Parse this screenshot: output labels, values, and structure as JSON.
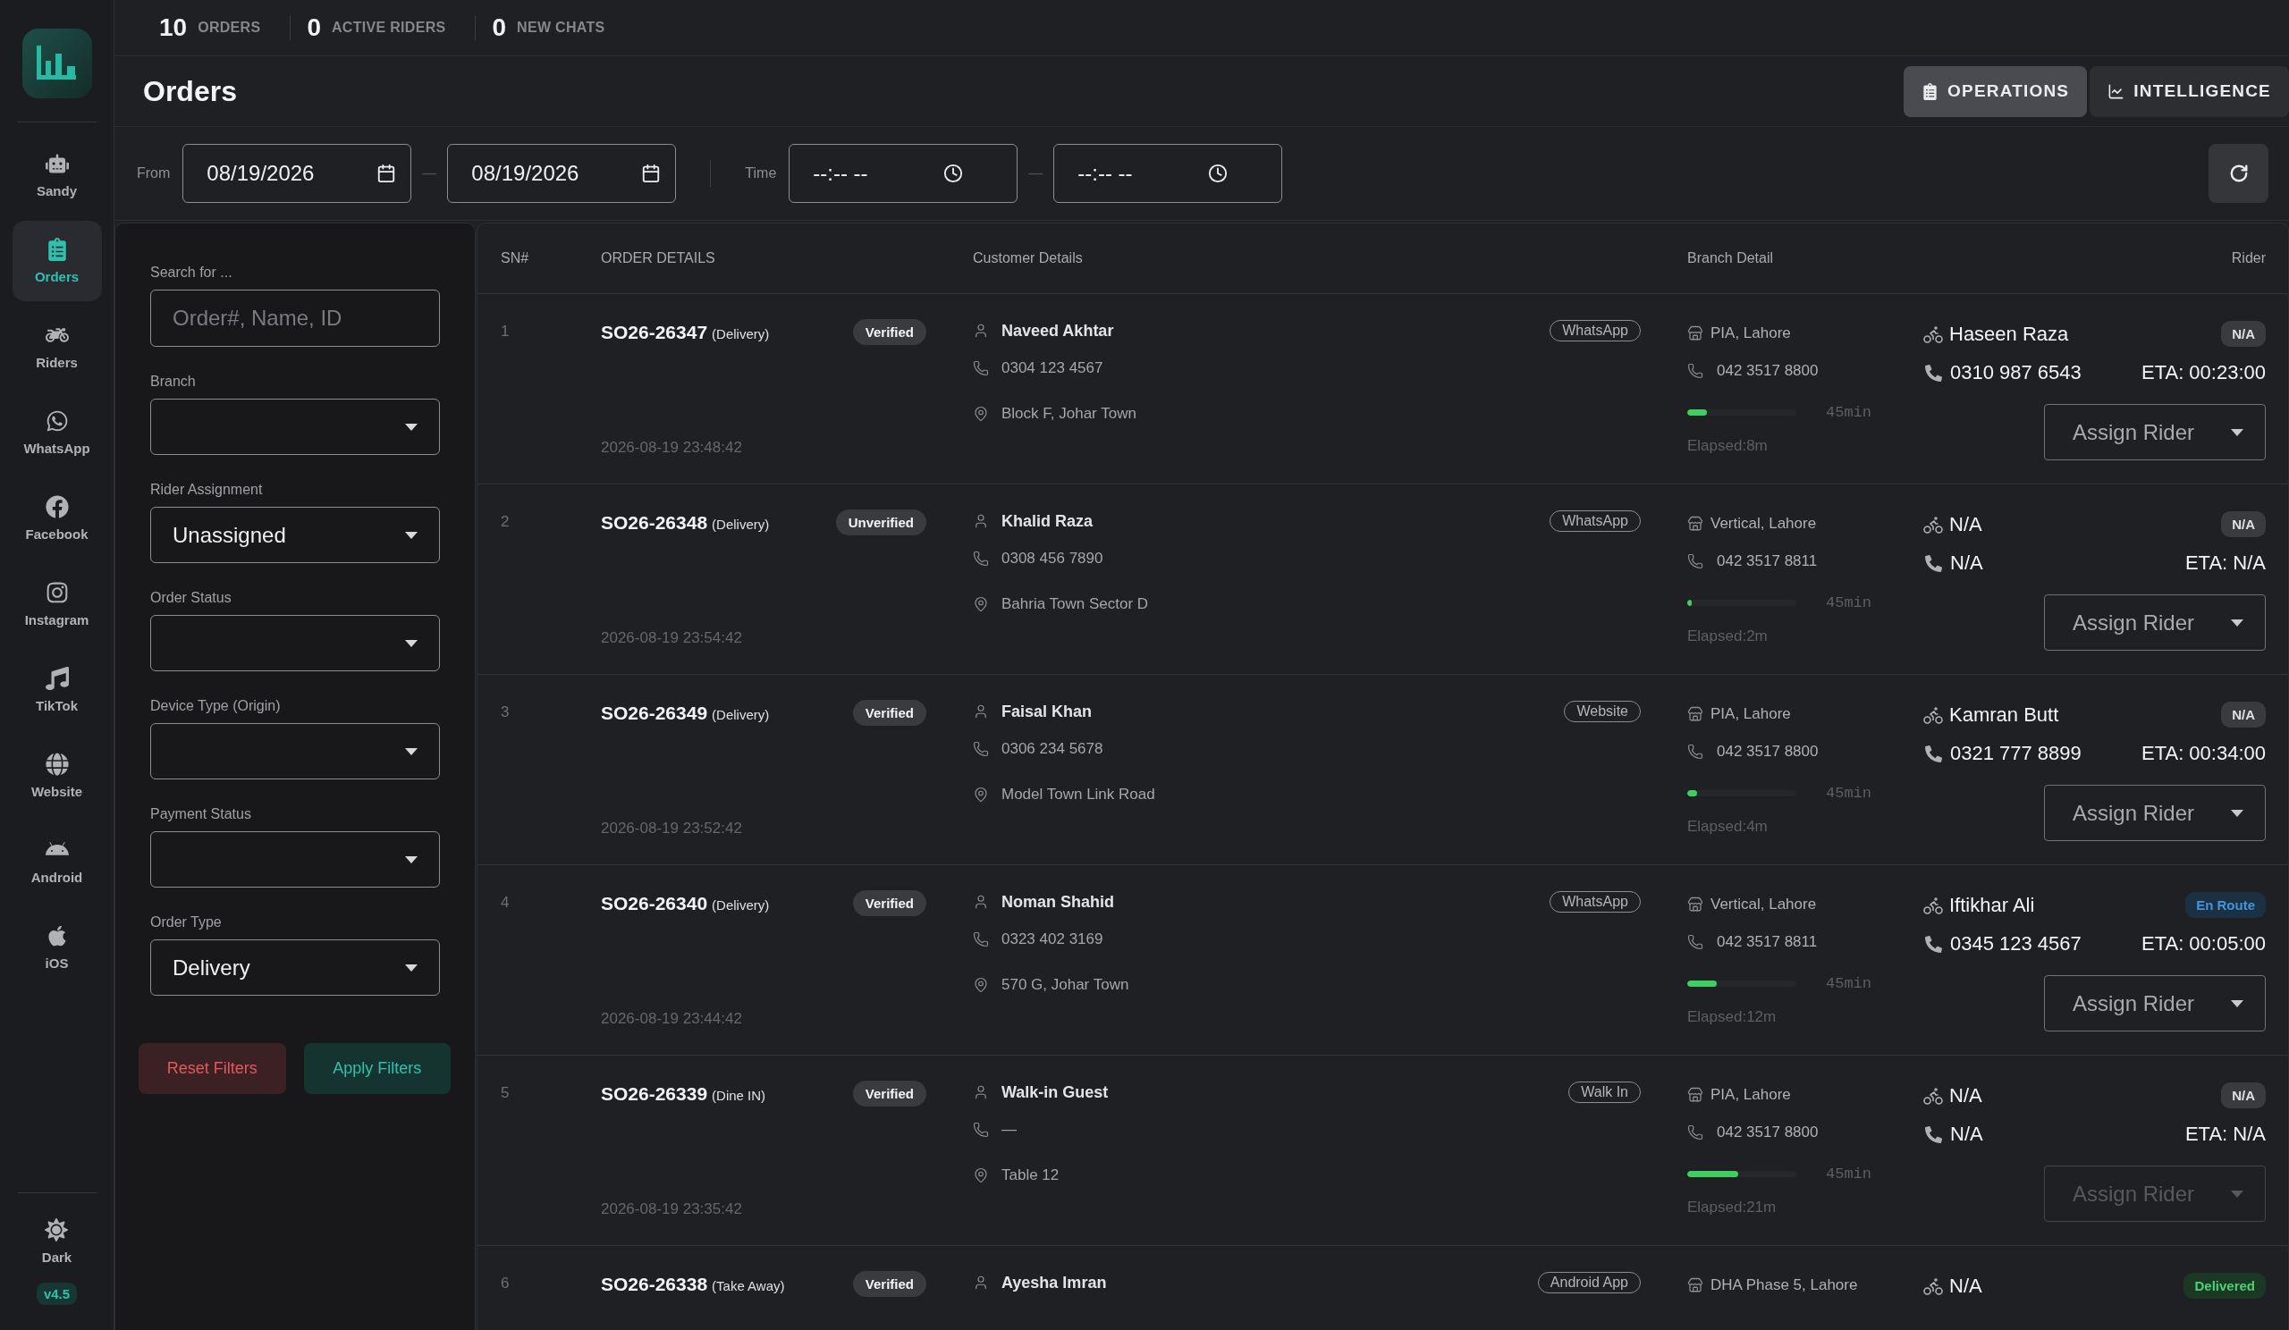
{
  "sidebar": {
    "nav": [
      {
        "label": "Sandy",
        "selected": false
      },
      {
        "label": "Orders",
        "selected": true
      },
      {
        "label": "Riders",
        "selected": false
      },
      {
        "label": "WhatsApp",
        "selected": false
      },
      {
        "label": "Facebook",
        "selected": false
      },
      {
        "label": "Instagram",
        "selected": false
      },
      {
        "label": "TikTok",
        "selected": false
      },
      {
        "label": "Website",
        "selected": false
      },
      {
        "label": "Android",
        "selected": false
      },
      {
        "label": "iOS",
        "selected": false
      }
    ],
    "theme_toggle": "Dark",
    "version": "v4.5"
  },
  "top_stats": [
    {
      "value": "10",
      "label": "ORDERS"
    },
    {
      "value": "0",
      "label": "ACTIVE RIDERS"
    },
    {
      "value": "0",
      "label": "NEW CHATS"
    }
  ],
  "page": {
    "title": "Orders",
    "tabs": [
      {
        "label": "OPERATIONS",
        "selected": true
      },
      {
        "label": "INTELLIGENCE",
        "selected": false
      }
    ]
  },
  "range_filter": {
    "from_label": "From",
    "date_from": "08/19/2026",
    "date_separator": "—",
    "date_to": "08/19/2026",
    "time_label": "Time",
    "time_from": "--:-- --",
    "time_separator": "—",
    "time_to": "--:-- --"
  },
  "filters": {
    "search": {
      "label": "Search for ...",
      "placeholder": "Order#, Name, ID"
    },
    "selects": [
      {
        "label": "Branch"
      },
      {
        "label": "Rider Assignment",
        "value": "Unassigned"
      },
      {
        "label": "Order Status"
      },
      {
        "label": "Device Type (Origin)"
      },
      {
        "label": "Payment Status"
      },
      {
        "label": "Order Type",
        "value": "Delivery"
      }
    ],
    "buttons": [
      {
        "label": "Reset Filters",
        "kind": "reset"
      },
      {
        "label": "Apply Filters",
        "kind": "apply"
      }
    ]
  },
  "table": {
    "columns": [
      "SN#",
      "ORDER DETAILS",
      "Customer Details",
      "Branch Detail",
      "Rider"
    ],
    "rows": [
      {
        "sn": "1",
        "order_id": "SO26-26347",
        "order_type": "(Delivery)",
        "verification": "Verified",
        "created": "2026-08-19 23:48:42",
        "customer": {
          "name": "Naveed Akhtar",
          "phone": "0304 123 4567",
          "address": "Block F, Johar Town",
          "source": "WhatsApp"
        },
        "branch": {
          "name": "PIA, Lahore",
          "phone": "042 3517 8800",
          "level": 0.18,
          "target": "45min",
          "elapsed": "Elapsed:8m"
        },
        "rider": {
          "name": "Haseen Raza",
          "status": "N/A",
          "color": "#3a3b3f",
          "phone": "0310 987 6543",
          "eta": "ETA: 00:23:00",
          "assign": {
            "label": "Assign Rider",
            "disabled": false
          }
        }
      },
      {
        "sn": "2",
        "order_id": "SO26-26348",
        "order_type": "(Delivery)",
        "verification": "Unverified",
        "created": "2026-08-19 23:54:42",
        "customer": {
          "name": "Khalid Raza",
          "phone": "0308 456 7890",
          "address": "Bahria Town Sector D",
          "source": "WhatsApp"
        },
        "branch": {
          "name": "Vertical, Lahore",
          "phone": "042 3517 8811",
          "level": 0.04,
          "target": "45min",
          "elapsed": "Elapsed:2m"
        },
        "rider": {
          "name": "N/A",
          "status": "N/A",
          "color": "#3a3b3f",
          "phone": "N/A",
          "eta": "ETA: N/A",
          "assign": {
            "label": "Assign Rider",
            "disabled": false
          }
        }
      },
      {
        "sn": "3",
        "order_id": "SO26-26349",
        "order_type": "(Delivery)",
        "verification": "Verified",
        "created": "2026-08-19 23:52:42",
        "customer": {
          "name": "Faisal Khan",
          "phone": "0306 234 5678",
          "address": "Model Town Link Road",
          "source": "Website"
        },
        "branch": {
          "name": "PIA, Lahore",
          "phone": "042 3517 8800",
          "level": 0.09,
          "target": "45min",
          "elapsed": "Elapsed:4m"
        },
        "rider": {
          "name": "Kamran Butt",
          "status": "N/A",
          "color": "#3a3b3f",
          "phone": "0321 777 8899",
          "eta": "ETA: 00:34:00",
          "assign": {
            "label": "Assign Rider",
            "disabled": false
          }
        }
      },
      {
        "sn": "4",
        "order_id": "SO26-26340",
        "order_type": "(Delivery)",
        "verification": "Verified",
        "created": "2026-08-19 23:44:42",
        "customer": {
          "name": "Noman Shahid",
          "phone": "0323 402 3169",
          "address": "570 G, Johar Town",
          "source": "WhatsApp"
        },
        "branch": {
          "name": "Vertical, Lahore",
          "phone": "042 3517 8811",
          "level": 0.27,
          "target": "45min",
          "elapsed": "Elapsed:12m"
        },
        "rider": {
          "name": "Iftikhar Ali",
          "status": "En Route",
          "color": "#1b3042",
          "phone": "0345 123 4567",
          "eta": "ETA: 00:05:00",
          "assign": {
            "label": "Assign Rider",
            "disabled": false
          }
        }
      },
      {
        "sn": "5",
        "order_id": "SO26-26339",
        "order_type": "(Dine IN)",
        "verification": "Verified",
        "created": "2026-08-19 23:35:42",
        "customer": {
          "name": "Walk-in Guest",
          "phone": "—",
          "address": "Table 12",
          "source": "Walk In"
        },
        "branch": {
          "name": "PIA, Lahore",
          "phone": "042 3517 8800",
          "level": 0.47,
          "target": "45min",
          "elapsed": "Elapsed:21m"
        },
        "rider": {
          "name": "N/A",
          "status": "N/A",
          "color": "#3a3b3f",
          "phone": "N/A",
          "eta": "ETA: N/A",
          "assign": {
            "label": "Assign Rider",
            "disabled": true
          }
        }
      },
      {
        "sn": "6",
        "order_id": "SO26-26338",
        "order_type": "(Take Away)",
        "verification": "Verified",
        "customer": {
          "name": "Ayesha Imran",
          "source": "Android App"
        },
        "branch": {
          "name": "DHA Phase 5, Lahore"
        },
        "rider": {
          "name": "N/A",
          "status": "Delivered",
          "color": "#1a3823"
        }
      }
    ]
  }
}
